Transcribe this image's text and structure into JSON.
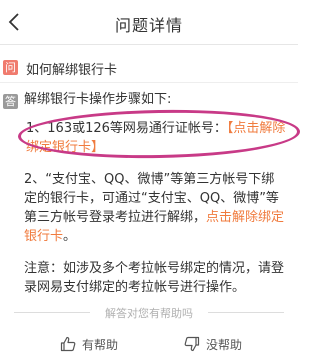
{
  "header": {
    "title": "问题详情"
  },
  "question": {
    "badge": "问",
    "text": "如何解绑银行卡"
  },
  "answer": {
    "badge": "答",
    "intro": "解绑银行卡操作步骤如下:",
    "step1_text": "1、163或126等网易通行证帐号：",
    "step1_link": "【点击解除绑定银行卡】",
    "step2_text": "2、“支付宝、QQ、微博”等第三方帐号下绑定的银行卡，可通过“支付宝、QQ、微博”等第三方帐号登录考拉进行解绑，",
    "step2_link": "点击解除绑定银行卡",
    "step2_end": "。",
    "note": "注意：如涉及多个考拉帐号绑定的情况，请登录网易支付绑定的考拉帐号进行操作。"
  },
  "feedback": {
    "prompt": "解答对您有帮助吗",
    "helpful_label": "有帮助",
    "not_helpful_label": "没帮助"
  }
}
